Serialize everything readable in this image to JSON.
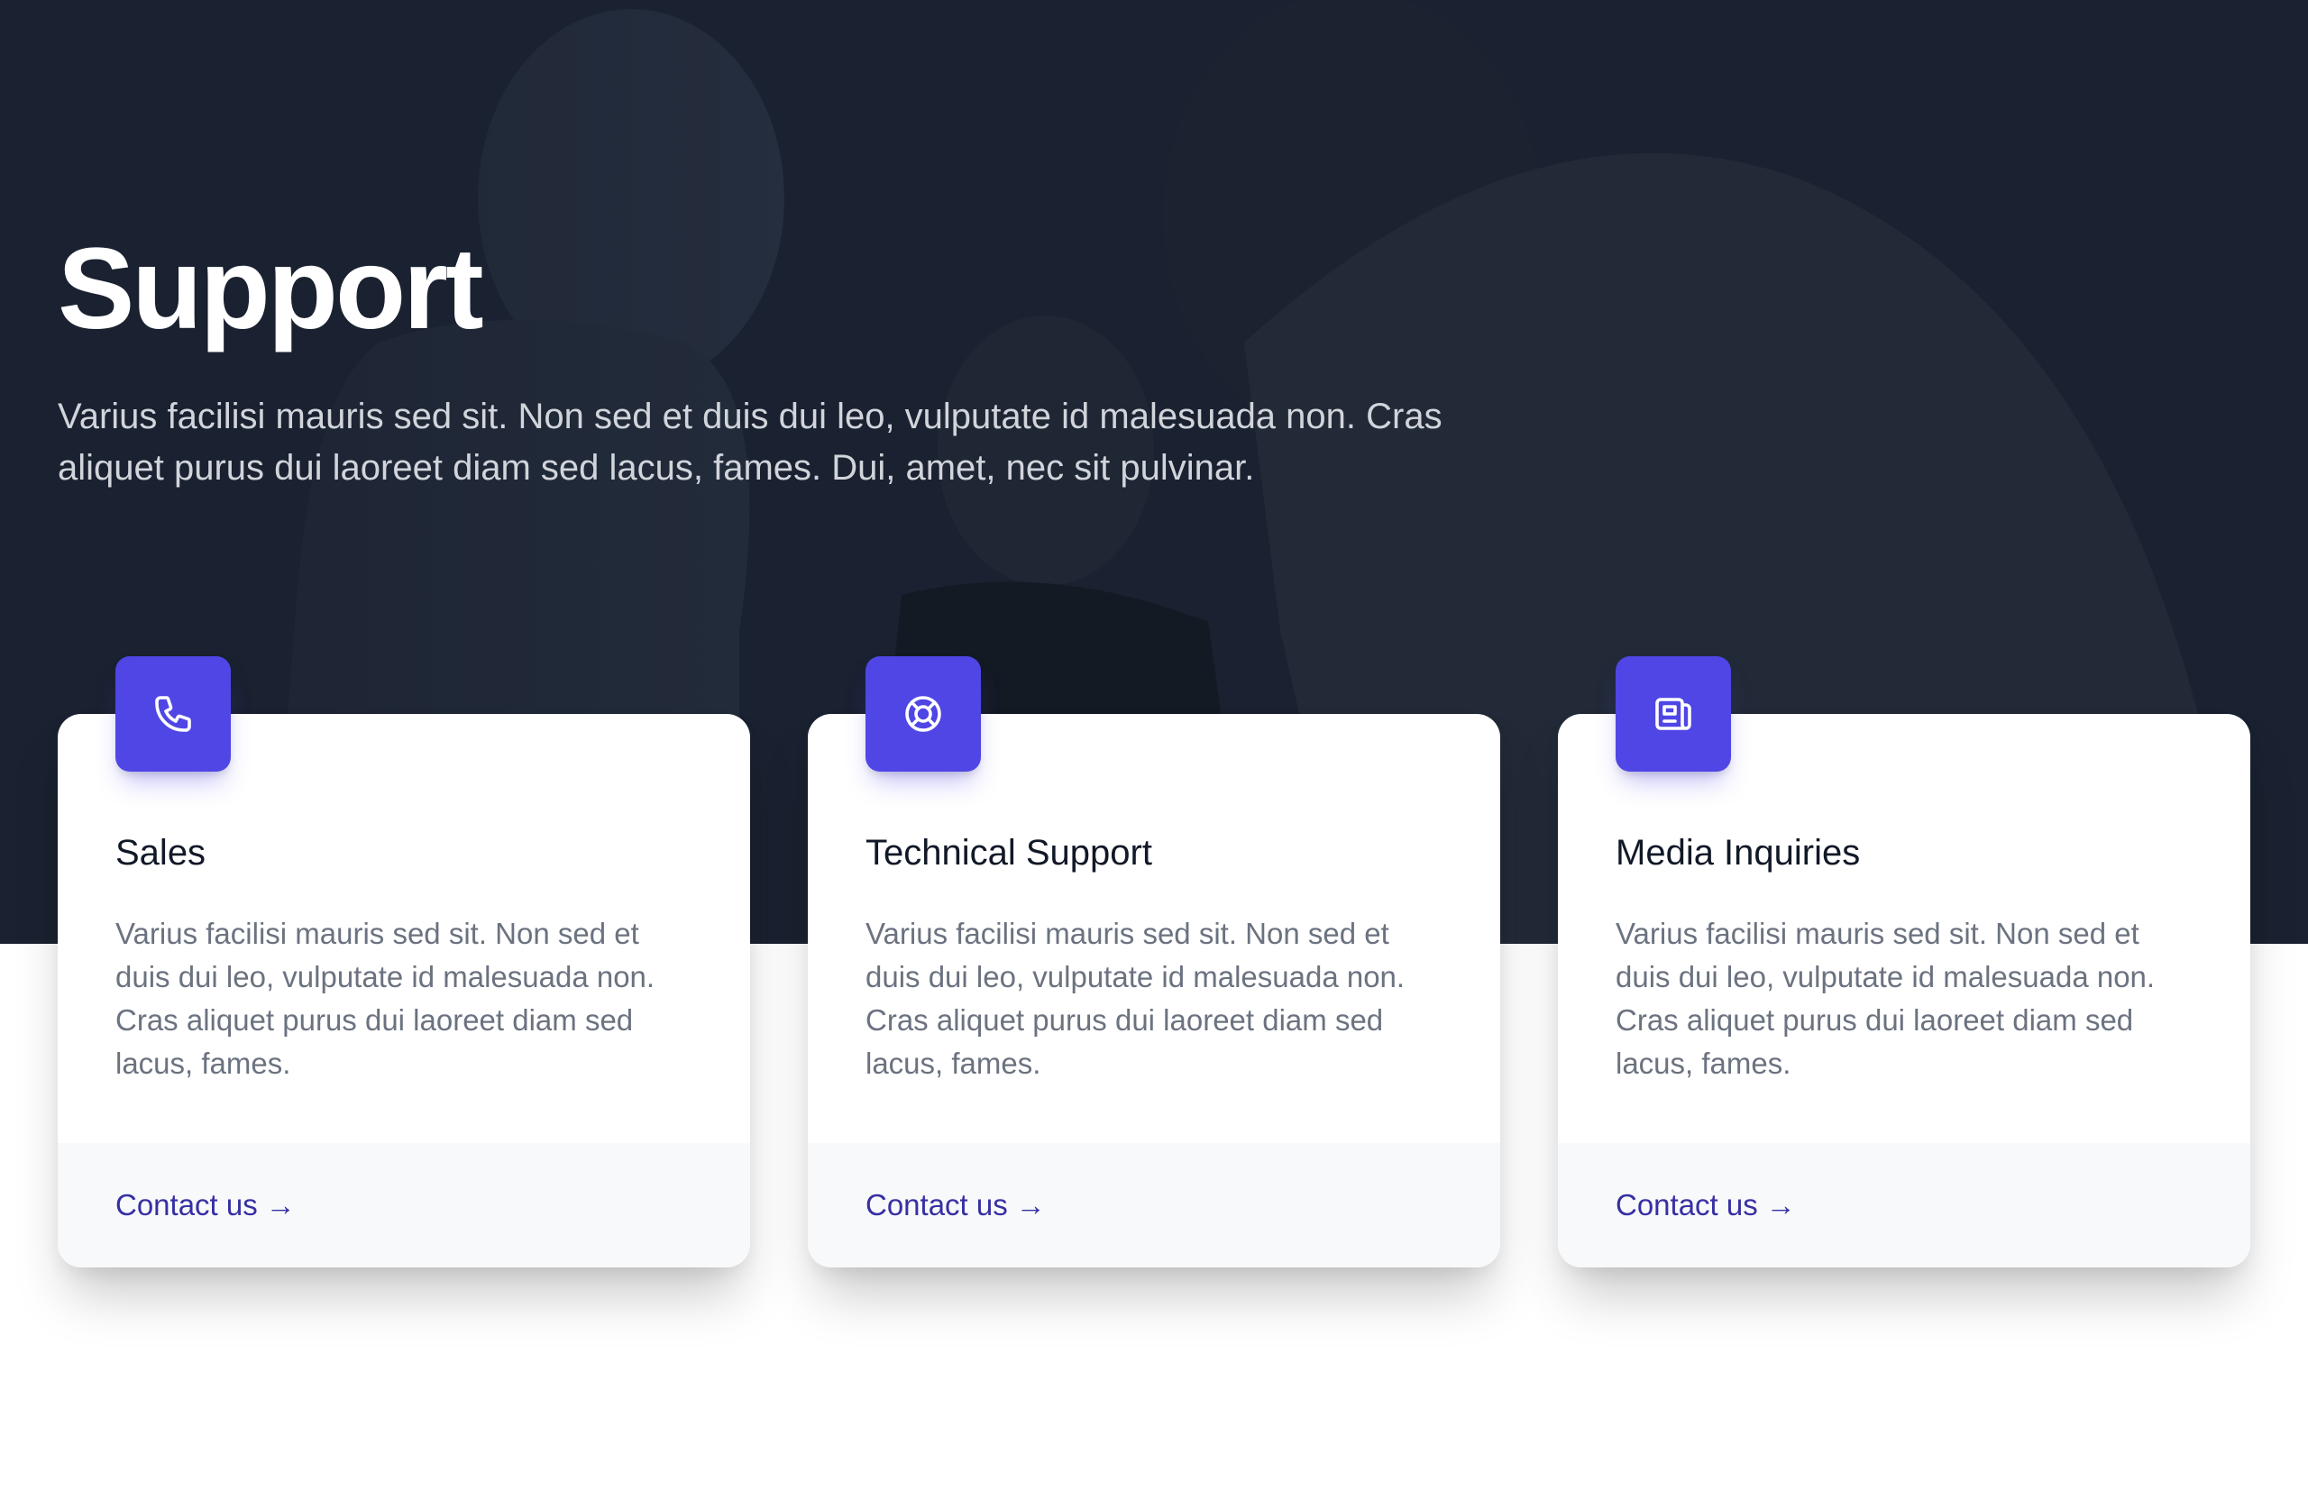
{
  "hero": {
    "title": "Support",
    "description": "Varius facilisi mauris sed sit. Non sed et duis dui leo, vulputate id malesuada non. Cras aliquet purus dui laoreet diam sed lacus, fames. Dui, amet, nec sit pulvinar."
  },
  "cards": [
    {
      "icon": "phone-icon",
      "title": "Sales",
      "description": "Varius facilisi mauris sed sit. Non sed et duis dui leo, vulputate id malesuada non. Cras aliquet purus dui laoreet diam sed lacus, fames.",
      "link_label": "Contact us",
      "link_arrow": "→"
    },
    {
      "icon": "lifebuoy-icon",
      "title": "Technical Support",
      "description": "Varius facilisi mauris sed sit. Non sed et duis dui leo, vulputate id malesuada non. Cras aliquet purus dui laoreet diam sed lacus, fames.",
      "link_label": "Contact us",
      "link_arrow": "→"
    },
    {
      "icon": "newspaper-icon",
      "title": "Media Inquiries",
      "description": "Varius facilisi mauris sed sit. Non sed et duis dui leo, vulputate id malesuada non. Cras aliquet purus dui laoreet diam sed lacus, fames.",
      "link_label": "Contact us",
      "link_arrow": "→"
    }
  ],
  "colors": {
    "hero_bg": "#1a2130",
    "accent": "#4f46e5",
    "link": "#3730a3",
    "card_footer_bg": "#f8f9fb"
  }
}
